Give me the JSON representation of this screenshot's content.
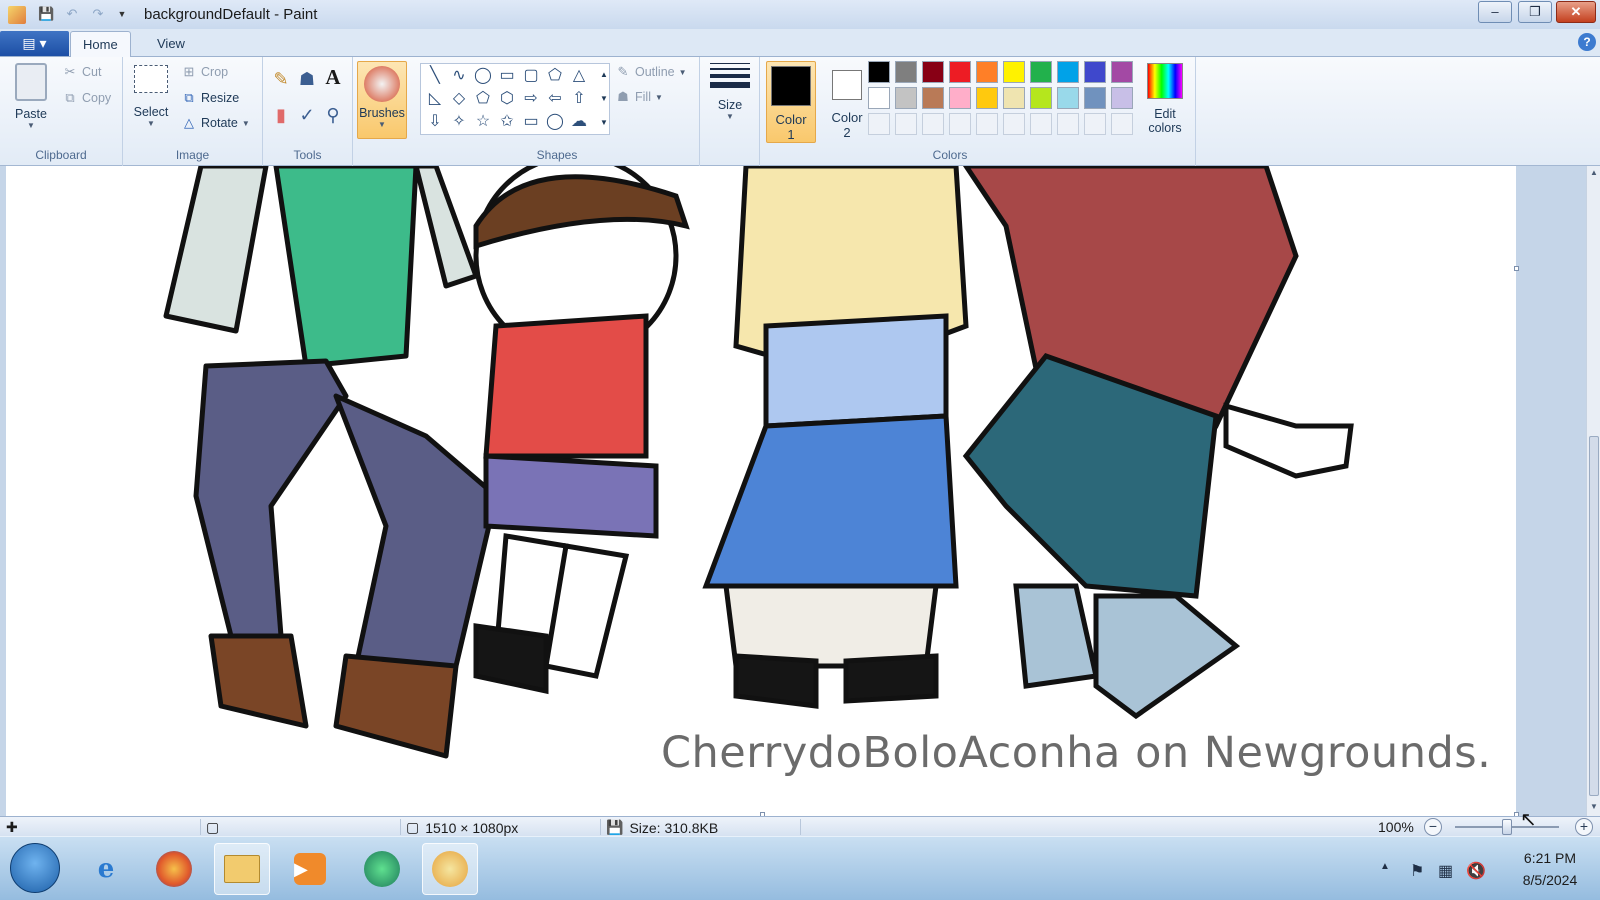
{
  "window": {
    "title": "backgroundDefault - Paint",
    "minimize_label": "–",
    "maximize_label": "❐",
    "close_label": "✕"
  },
  "tabs": {
    "app_menu_label": "▤ ▾",
    "home": "Home",
    "view": "View",
    "help_label": "?"
  },
  "ribbon": {
    "clipboard": {
      "group_label": "Clipboard",
      "paste": "Paste",
      "cut": "Cut",
      "copy": "Copy"
    },
    "image": {
      "group_label": "Image",
      "select": "Select",
      "crop": "Crop",
      "resize": "Resize",
      "rotate": "Rotate"
    },
    "tools": {
      "group_label": "Tools",
      "text_glyph": "A"
    },
    "brushes": {
      "label": "Brushes"
    },
    "shapes": {
      "group_label": "Shapes",
      "outline": "Outline",
      "fill": "Fill",
      "glyphs": [
        "╲",
        "∿",
        "◯",
        "▭",
        "▢",
        "⬠",
        "△",
        "◺",
        "◇",
        "⬠",
        "⬡",
        "⇨",
        "⇦",
        "⇧",
        "⇩",
        "✧",
        "☆",
        "✩",
        "▭",
        "◯",
        "☁"
      ]
    },
    "size": {
      "label": "Size"
    },
    "colors": {
      "group_label": "Colors",
      "color1_line1": "Color",
      "color1_line2": "1",
      "color2_line1": "Color",
      "color2_line2": "2",
      "color1_value": "#000000",
      "color2_value": "#ffffff",
      "edit_line1": "Edit",
      "edit_line2": "colors",
      "palette_row1": [
        "#000000",
        "#7f7f7f",
        "#880015",
        "#ed1c24",
        "#ff7f27",
        "#fff200",
        "#22b14c",
        "#00a2e8",
        "#3f48cc",
        "#a349a4"
      ],
      "palette_row2": [
        "#ffffff",
        "#c3c3c3",
        "#b97a57",
        "#ffaec9",
        "#ffc90e",
        "#efe4b0",
        "#b5e61d",
        "#99d9ea",
        "#7092be",
        "#c8bfe7"
      ]
    }
  },
  "canvas": {
    "watermark": "CherrydoBoloAconha on Newgrounds."
  },
  "statusbar": {
    "dimensions": "1510 × 1080px",
    "size": "Size: 310.8KB",
    "zoom": "100%"
  },
  "taskbar": {
    "time": "6:21 PM",
    "date": "8/5/2024"
  }
}
